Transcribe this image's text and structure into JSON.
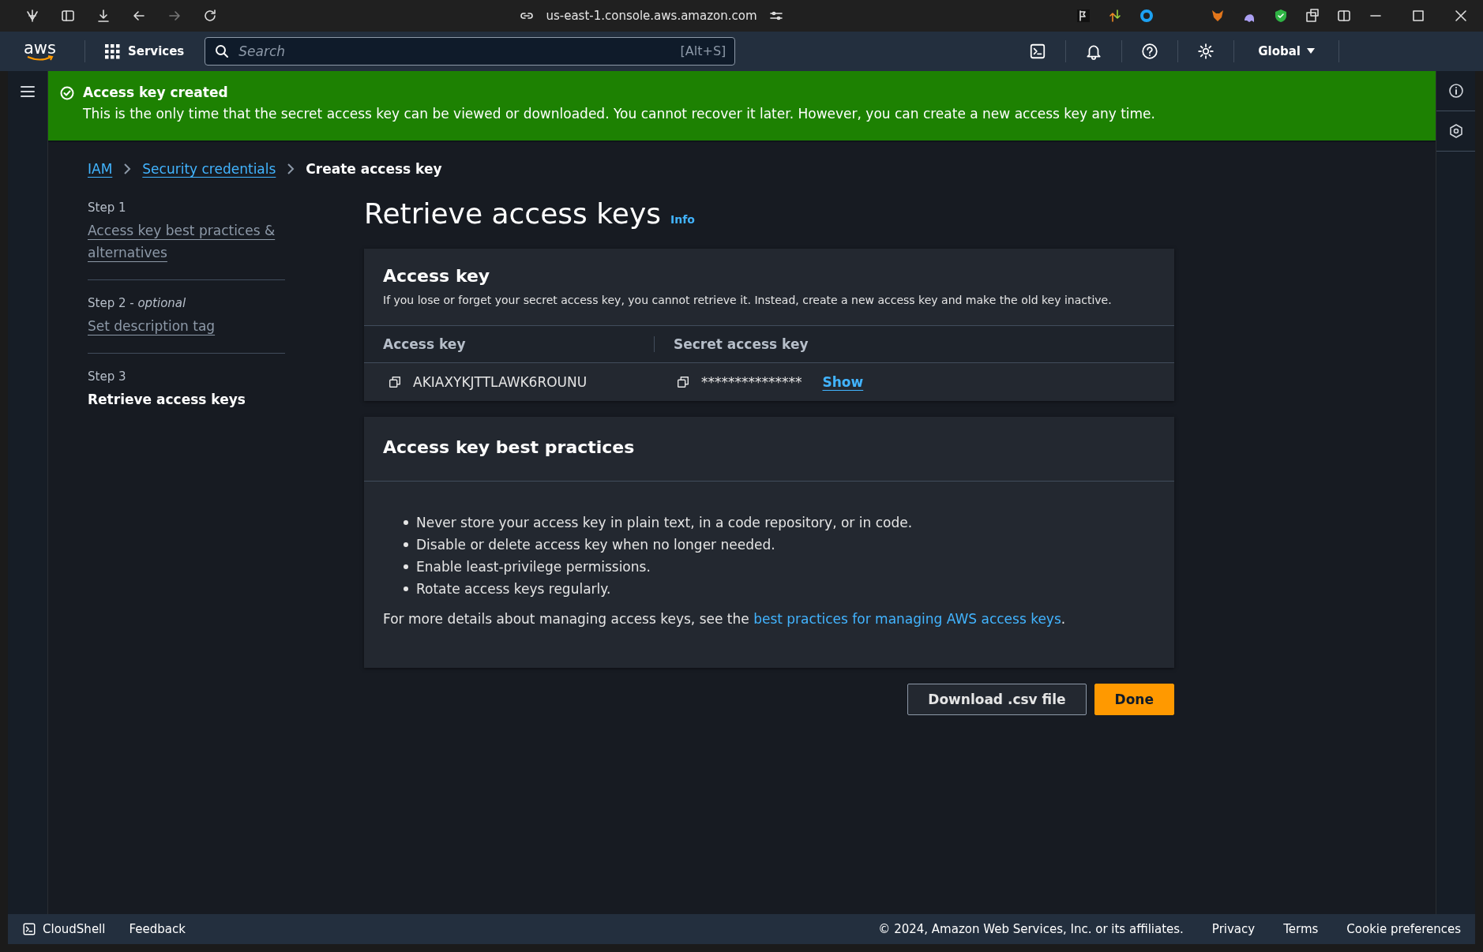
{
  "browser": {
    "url": "us-east-1.console.aws.amazon.com"
  },
  "topnav": {
    "logo": "aws",
    "services": "Services",
    "search_placeholder": "Search",
    "shortcut": "[Alt+S]",
    "region": "Global"
  },
  "flash": {
    "title": "Access key created",
    "message": "This is the only time that the secret access key can be viewed or downloaded. You cannot recover it later. However, you can create a new access key any time."
  },
  "breadcrumbs": [
    {
      "label": "IAM",
      "link": true
    },
    {
      "label": "Security credentials",
      "link": true
    },
    {
      "label": "Create access key",
      "link": false
    }
  ],
  "steps": [
    {
      "step": "Step 1",
      "label": "Access key best practices & alternatives",
      "selected": false
    },
    {
      "step": "Step 2 - *optional*",
      "label": "Set description tag",
      "selected": false
    },
    {
      "step": "Step 3",
      "label": "Retrieve access keys",
      "selected": true
    }
  ],
  "page": {
    "title": "Retrieve access keys",
    "info": "Info"
  },
  "access_key_panel": {
    "title": "Access key",
    "description": "If you lose or forget your secret access key, you cannot retrieve it. Instead, create a new access key and make the old key inactive.",
    "columns": [
      "Access key",
      "Secret access key"
    ],
    "access_key": "AKIAXYKJTTLAWK6ROUNU",
    "secret_key": "***************",
    "show": "Show"
  },
  "best_practices": {
    "title": "Access key best practices",
    "items": [
      "Never store your access key in plain text, in a code repository, or in code.",
      "Disable or delete access key when no longer needed.",
      "Enable least-privilege permissions.",
      "Rotate access keys regularly."
    ],
    "note": {
      "text": "For more details about managing access keys, see the ",
      "link": "best practices for managing AWS access keys",
      "end": "."
    }
  },
  "buttons": [
    {
      "label": "Download .csv file",
      "kind": "secondary"
    },
    {
      "label": "Done",
      "kind": "primary"
    }
  ],
  "footer": {
    "cloudshell": "CloudShell",
    "feedback": "Feedback",
    "copyright": "© 2024, Amazon Web Services, Inc. or its affiliates.",
    "links": [
      "Privacy",
      "Terms",
      "Cookie preferences"
    ]
  }
}
